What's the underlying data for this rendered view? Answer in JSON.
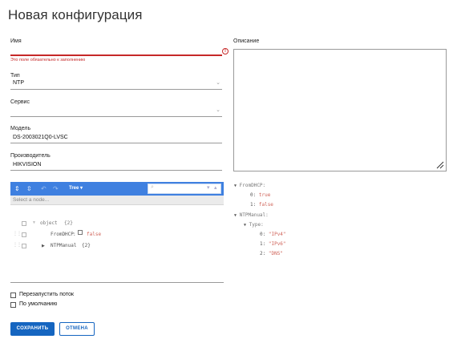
{
  "page_title": "Новая конфигурация",
  "form": {
    "name": {
      "label": "Имя",
      "value": "",
      "error": "Это поле обязательно к заполнению",
      "error_icon": "!"
    },
    "type": {
      "label": "Тип",
      "value": "NTP"
    },
    "service": {
      "label": "Сервис",
      "value": ""
    },
    "model": {
      "label": "Модель",
      "value": "DS-2003021Q0-LVSC"
    },
    "manufacturer": {
      "label": "Производитель",
      "value": "HIKVISION"
    },
    "description": {
      "label": "Описание",
      "value": ""
    }
  },
  "json_editor": {
    "mode_label": "Tree ▾",
    "search_placeholder": "",
    "navbar_placeholder": "Select a node...",
    "tree": {
      "root_key": "object",
      "root_count": "{2}",
      "row1_key": "FromDHCP",
      "row1_colon": ":",
      "row1_value": "false",
      "row2_key": "NTPManual",
      "row2_count": "{2}"
    }
  },
  "json_preview": {
    "fromdhcp_key": "FromDHCP:",
    "fromdhcp_0_idx": "0:",
    "fromdhcp_0_val": "true",
    "fromdhcp_1_idx": "1:",
    "fromdhcp_1_val": "false",
    "ntpmanual_key": "NTPManual:",
    "type_key": "Type:",
    "type_0_idx": "0:",
    "type_0_val": "\"IPv4\"",
    "type_1_idx": "1:",
    "type_1_val": "\"IPv6\"",
    "type_2_idx": "2:",
    "type_2_val": "\"DNS\""
  },
  "checkboxes": {
    "restart_flow": {
      "label": "Перезапустить поток",
      "checked": false
    },
    "default": {
      "label": "По умолчанию",
      "checked": false
    }
  },
  "buttons": {
    "save": "СОХРАНИТЬ",
    "cancel": "ОТМЕНА"
  },
  "colors": {
    "primary": "#1565c0",
    "error": "#c62828",
    "toolbar": "#3f80e0",
    "json_value": "#d0645a"
  }
}
